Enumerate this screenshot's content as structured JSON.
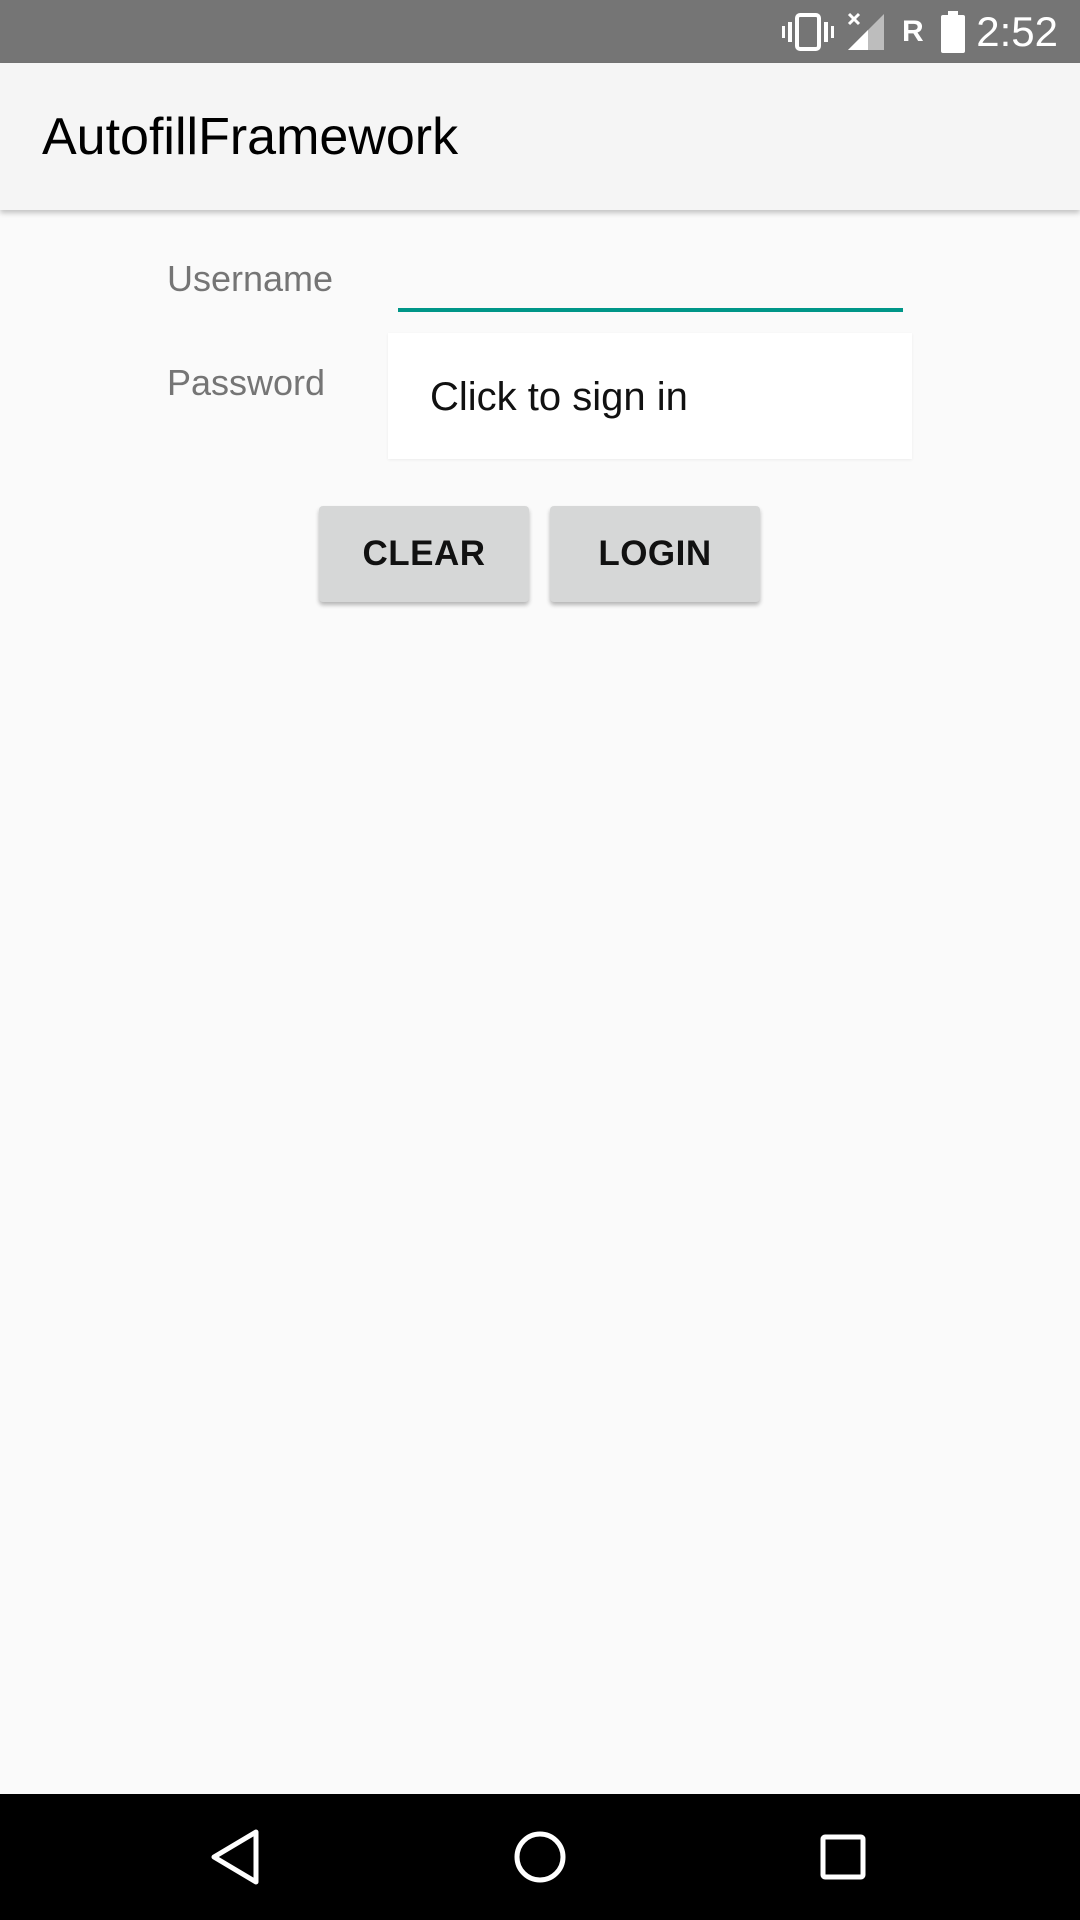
{
  "status_bar": {
    "time": "2:52",
    "roaming": "R",
    "icons": [
      "vibrate-icon",
      "signal-no-data-icon",
      "battery-icon"
    ],
    "background": "#757575"
  },
  "app_bar": {
    "title": "AutofillFramework"
  },
  "form": {
    "username_label": "Username",
    "username_value": "",
    "password_label": "Password",
    "autofill_suggestion": "Click to sign in",
    "accent_color": "#009688"
  },
  "buttons": {
    "clear_label": "CLEAR",
    "login_label": "LOGIN"
  },
  "nav_bar": {
    "icons": [
      "back-icon",
      "home-icon",
      "recents-icon"
    ]
  }
}
